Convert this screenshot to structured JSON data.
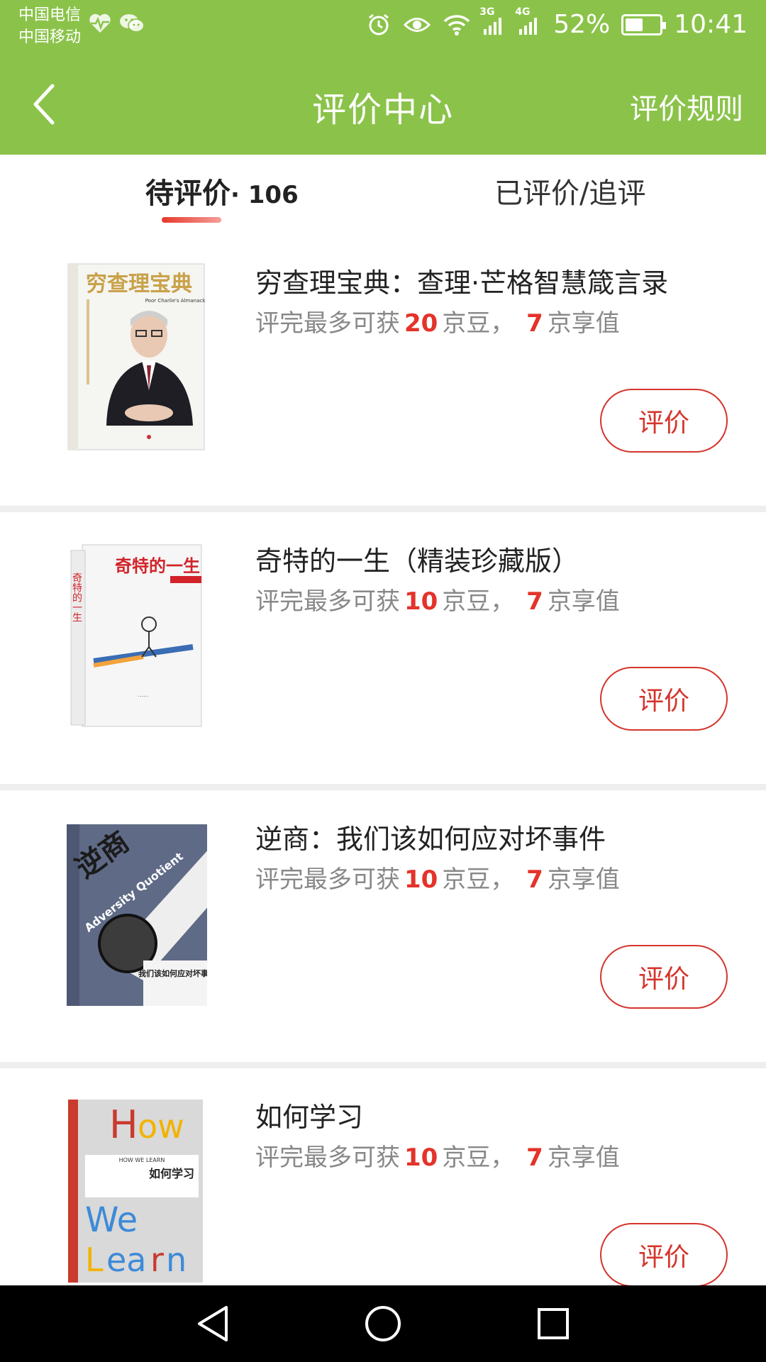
{
  "status_bar": {
    "carrier_1": "中国电信",
    "carrier_2": "中国移动",
    "network_1": "3G",
    "network_2": "4G",
    "battery": "52%",
    "battery_level": 0.52,
    "time": "10:41"
  },
  "header": {
    "title": "评价中心",
    "rules_label": "评价规则",
    "background_color": "#8bc34a"
  },
  "tabs": {
    "pending_label": "待评价",
    "pending_count": "· 106",
    "done_label": "已评价/追评"
  },
  "items": [
    {
      "title": "穷查理宝典：查理·芒格智慧箴言录",
      "reward_prefix": "评完最多可获",
      "beans": "20",
      "beans_unit": "京豆，",
      "value": "7",
      "value_unit": "京享值",
      "button_label": "评价",
      "cover_title": "穷查理宝典",
      "cover_subtitle": "Poor Charlie's Almanack"
    },
    {
      "title": "奇特的一生（精装珍藏版）",
      "reward_prefix": "评完最多可获",
      "beans": "10",
      "beans_unit": "京豆，",
      "value": "7",
      "value_unit": "京享值",
      "button_label": "评价",
      "cover_title": "奇特的一生"
    },
    {
      "title": "逆商：我们该如何应对坏事件",
      "reward_prefix": "评完最多可获",
      "beans": "10",
      "beans_unit": "京豆，",
      "value": "7",
      "value_unit": "京享值",
      "button_label": "评价",
      "cover_title": "逆商",
      "cover_subtitle": "Adversity Quotient",
      "cover_tagline": "我们该如何应对坏事件"
    },
    {
      "title": "如何学习",
      "reward_prefix": "评完最多可获",
      "beans": "10",
      "beans_unit": "京豆，",
      "value": "7",
      "value_unit": "京享值",
      "button_label": "评价",
      "cover_title": "如何学习",
      "cover_subtitle": "HOW WE LEARN"
    }
  ],
  "colors": {
    "accent_red": "#e4332a",
    "green": "#8bc34a"
  }
}
